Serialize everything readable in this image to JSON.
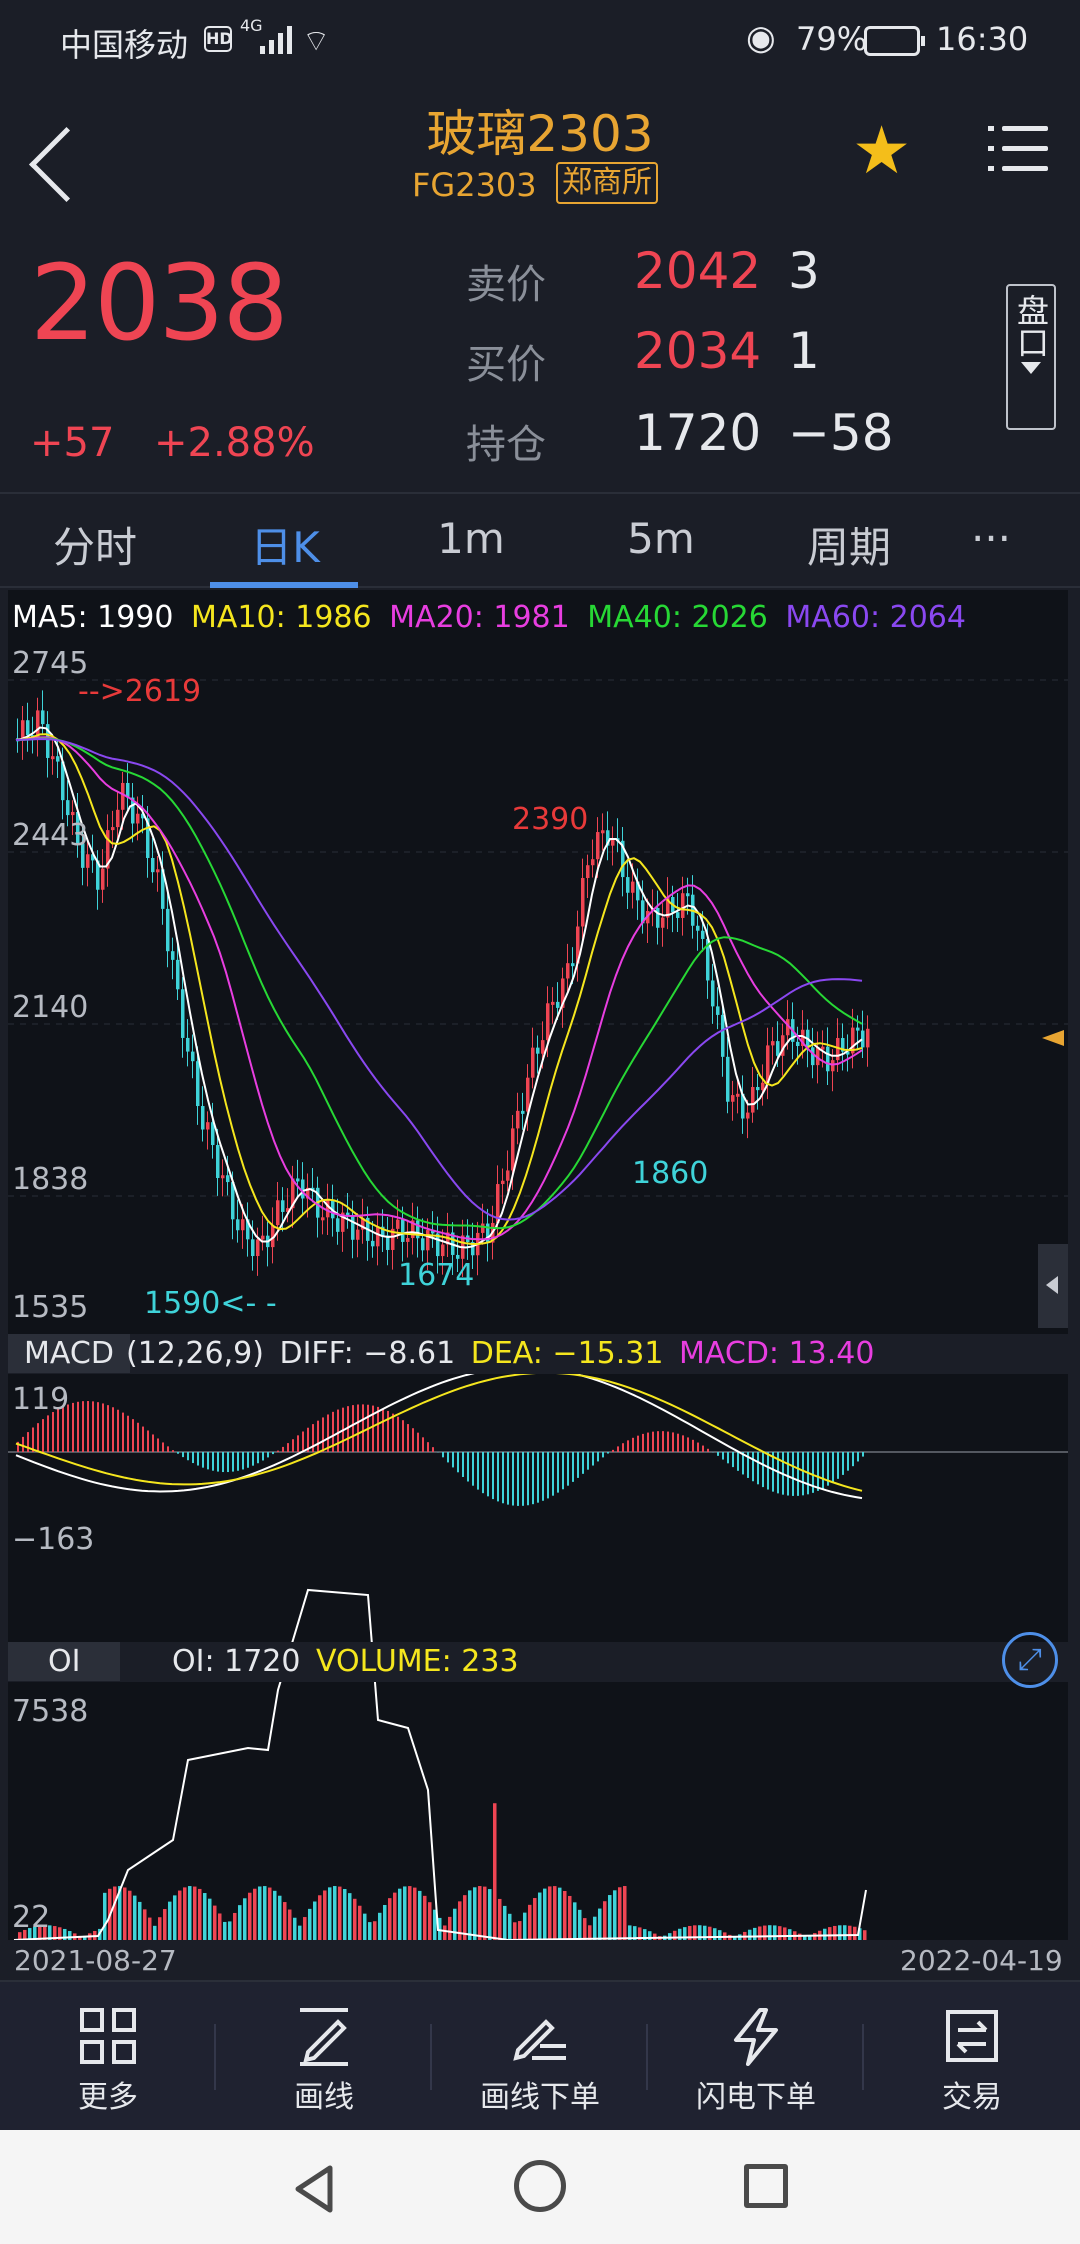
{
  "status": {
    "carrier": "中国移动",
    "hd": "HD",
    "network": "4G",
    "battery": "79%",
    "time": "16:30"
  },
  "header": {
    "title": "玻璃2303",
    "code": "FG2303",
    "exchange": "郑商所"
  },
  "quote": {
    "last": "2038",
    "change": "+57",
    "change_pct": "+2.88%",
    "rows": [
      {
        "label": "卖价",
        "value": "2042",
        "qty": "3"
      },
      {
        "label": "买价",
        "value": "2034",
        "qty": "1"
      },
      {
        "label": "持仓",
        "value": "1720",
        "qty": "−58"
      }
    ],
    "pankou": "盘口"
  },
  "tabs": [
    {
      "label": "分时",
      "active": false
    },
    {
      "label": "日K",
      "active": true
    },
    {
      "label": "1m",
      "active": false
    },
    {
      "label": "5m",
      "active": false
    },
    {
      "label": "周期",
      "active": false
    },
    {
      "label": "···",
      "active": false
    }
  ],
  "ma_legend": [
    {
      "text": "MA5: 1990",
      "color": "#ffffff"
    },
    {
      "text": "MA10: 1986",
      "color": "#f5e61e"
    },
    {
      "text": "MA20: 1981",
      "color": "#e83ee0"
    },
    {
      "text": "MA40: 2026",
      "color": "#27d835"
    },
    {
      "text": "MA60: 2064",
      "color": "#8a48f0"
    }
  ],
  "price_axis": [
    "2745",
    "2443",
    "2140",
    "1838",
    "1535"
  ],
  "annotations": {
    "high_left": "-->2619",
    "peak": "2390",
    "low": "1590<- -",
    "trough1": "1674",
    "trough2": "1860"
  },
  "macd": {
    "tag": "MACD",
    "params": "(12,26,9)",
    "diff": "DIFF: −8.61",
    "dea": "DEA: −15.31",
    "macd": "MACD: 13.40",
    "top": "119",
    "bottom": "−163"
  },
  "oi": {
    "tag": "OI",
    "oi": "OI: 1720",
    "volume": "VOLUME: 233",
    "top": "7538",
    "bottom": "22"
  },
  "dates": {
    "start": "2021-08-27",
    "end": "2022-04-19"
  },
  "toolbar": [
    {
      "label": "更多",
      "icon": "grid-icon"
    },
    {
      "label": "画线",
      "icon": "draw-line-icon"
    },
    {
      "label": "画线下单",
      "icon": "draw-order-icon"
    },
    {
      "label": "闪电下单",
      "icon": "lightning-icon"
    },
    {
      "label": "交易",
      "icon": "trade-icon"
    }
  ],
  "colors": {
    "up": "#ef4553",
    "down": "#3fd3d9",
    "accent": "#4e8fe8",
    "gold": "#e8a532"
  }
}
